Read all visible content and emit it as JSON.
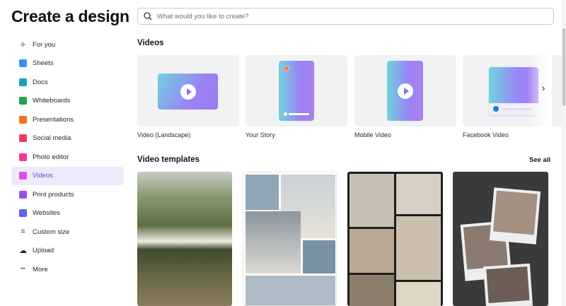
{
  "title": "Create a design",
  "search": {
    "placeholder": "What would you like to create?"
  },
  "sidebar": {
    "items": [
      {
        "label": "For you",
        "icon": "sparkle-icon",
        "color": "#222222"
      },
      {
        "label": "Sheets",
        "icon": "sheets-icon",
        "color": "#3b8cf5"
      },
      {
        "label": "Docs",
        "icon": "docs-icon",
        "color": "#19a3b8"
      },
      {
        "label": "Whiteboards",
        "icon": "whiteboard-icon",
        "color": "#1fa355"
      },
      {
        "label": "Presentations",
        "icon": "presentation-icon",
        "color": "#f5711c"
      },
      {
        "label": "Social media",
        "icon": "heart-icon",
        "color": "#f03a5a"
      },
      {
        "label": "Photo editor",
        "icon": "camera-icon",
        "color": "#f0388f"
      },
      {
        "label": "Videos",
        "icon": "video-icon",
        "color": "#e04ee8",
        "active": true
      },
      {
        "label": "Print products",
        "icon": "printer-icon",
        "color": "#9a4df0"
      },
      {
        "label": "Websites",
        "icon": "website-icon",
        "color": "#5a63f0"
      },
      {
        "label": "Custom size",
        "icon": "crop-icon",
        "color": "#222222"
      },
      {
        "label": "Upload",
        "icon": "cloud-upload-icon",
        "color": "#222222"
      },
      {
        "label": "More",
        "icon": "more-icon",
        "color": "#222222"
      }
    ]
  },
  "videos": {
    "heading": "Videos",
    "cards": [
      "Video (Landscape)",
      "Your Story",
      "Mobile Video",
      "Facebook Video"
    ]
  },
  "templates": {
    "heading": "Video templates",
    "see_all": "See all"
  }
}
